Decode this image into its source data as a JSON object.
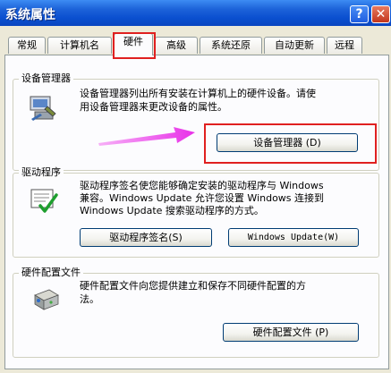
{
  "window": {
    "title": "系统属性",
    "help_label": "?",
    "close_label": "✕"
  },
  "tabs": [
    {
      "label": "常规"
    },
    {
      "label": "计算机名"
    },
    {
      "label": "硬件"
    },
    {
      "label": "高级"
    },
    {
      "label": "系统还原"
    },
    {
      "label": "自动更新"
    },
    {
      "label": "远程"
    }
  ],
  "active_tab": "硬件",
  "device_manager": {
    "title": "设备管理器",
    "description_line1": "设备管理器列出所有安装在计算机上的硬件设备。请使",
    "description_line2": "用设备管理器来更改设备的属性。",
    "button_label": "设备管理器 (D)",
    "icon": "device-manager-icon"
  },
  "drivers": {
    "title": "驱动程序",
    "description_line1": "驱动程序签名使您能够确定安装的驱动程序与 Windows",
    "description_line2": "兼容。Windows Update 允许您设置 Windows 连接到",
    "description_line3": "Windows Update 搜索驱动程序的方式。",
    "signing_button_label": "驱动程序签名(S)",
    "update_button_label": "Windows Update(W)",
    "icon": "driver-signing-icon"
  },
  "hardware_profiles": {
    "title": "硬件配置文件",
    "description_line1": "硬件配置文件向您提供建立和保存不同硬件配置的方",
    "description_line2": "法。",
    "button_label": "硬件配置文件 (P)",
    "icon": "hardware-profile-icon"
  },
  "annotation_color": "#e02020",
  "arrow_color": "#ee44ee"
}
